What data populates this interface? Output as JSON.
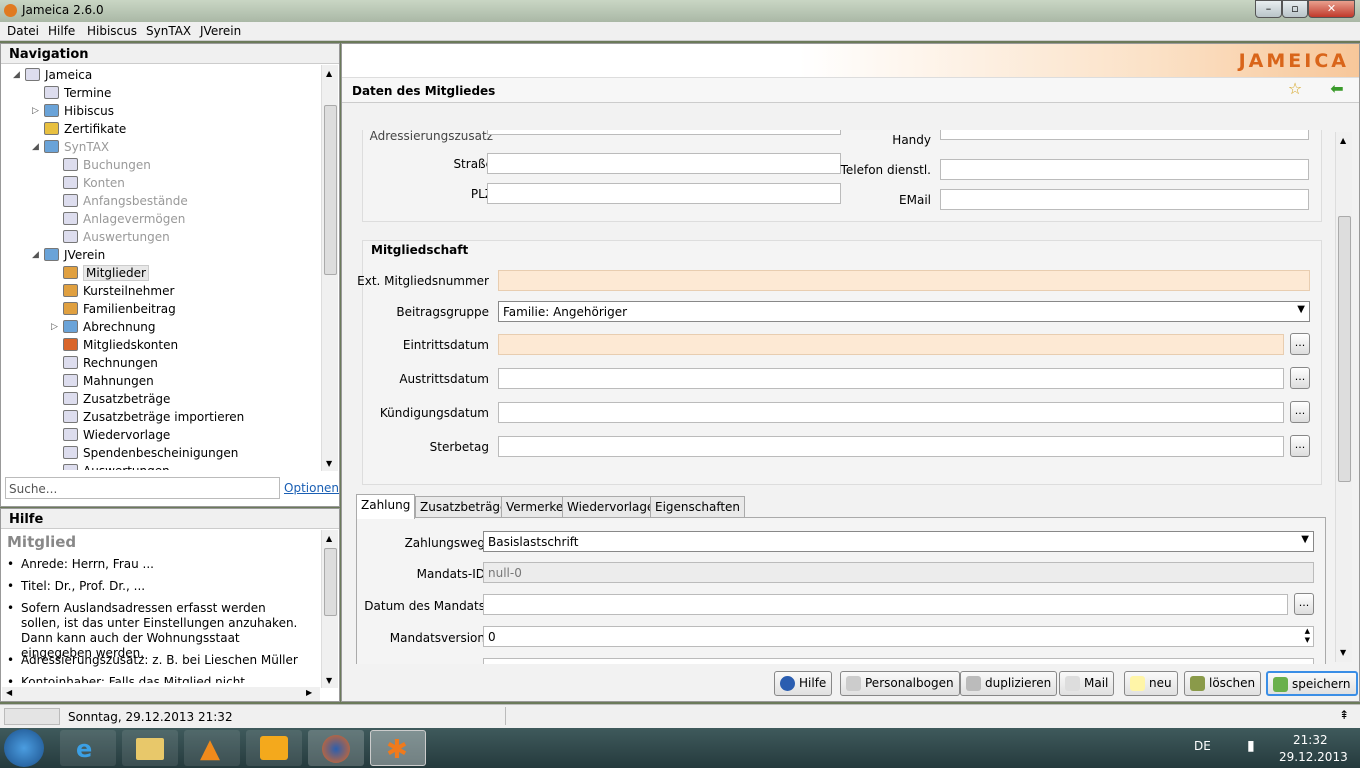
{
  "window": {
    "title": "Jameica 2.6.0"
  },
  "menu": [
    "Datei",
    "Hilfe",
    "Hibiscus",
    "SynTAX",
    "JVerein"
  ],
  "nav": {
    "header": "Navigation",
    "items": [
      {
        "label": "Jameica",
        "level": 0,
        "icon": "computer-icon"
      },
      {
        "label": "Termine",
        "level": 1,
        "icon": "calendar-icon"
      },
      {
        "label": "Hibiscus",
        "level": 1,
        "icon": "folder-icon"
      },
      {
        "label": "Zertifikate",
        "level": 1,
        "icon": "certificate-icon"
      },
      {
        "label": "SynTAX",
        "level": 1,
        "icon": "folder-icon",
        "disabled": true
      },
      {
        "label": "Buchungen",
        "level": 2,
        "icon": "ledger-icon",
        "disabled": true
      },
      {
        "label": "Konten",
        "level": 2,
        "icon": "ledger-icon",
        "disabled": true
      },
      {
        "label": "Anfangsbestände",
        "level": 2,
        "icon": "ledger-icon",
        "disabled": true
      },
      {
        "label": "Anlagevermögen",
        "level": 2,
        "icon": "ledger-icon",
        "disabled": true
      },
      {
        "label": "Auswertungen",
        "level": 2,
        "icon": "report-icon",
        "disabled": true
      },
      {
        "label": "JVerein",
        "level": 1,
        "icon": "folder-icon"
      },
      {
        "label": "Mitglieder",
        "level": 2,
        "icon": "members-icon",
        "selected": true
      },
      {
        "label": "Kursteilnehmer",
        "level": 2,
        "icon": "members-icon"
      },
      {
        "label": "Familienbeitrag",
        "level": 2,
        "icon": "family-icon"
      },
      {
        "label": "Abrechnung",
        "level": 2,
        "icon": "folder-icon"
      },
      {
        "label": "Mitgliedskonten",
        "level": 2,
        "icon": "accounts-icon"
      },
      {
        "label": "Rechnungen",
        "level": 2,
        "icon": "invoice-icon"
      },
      {
        "label": "Mahnungen",
        "level": 2,
        "icon": "reminder-icon"
      },
      {
        "label": "Zusatzbeträge",
        "level": 2,
        "icon": "pencil-icon"
      },
      {
        "label": "Zusatzbeträge importieren",
        "level": 2,
        "icon": "pencil-icon"
      },
      {
        "label": "Wiedervorlage",
        "level": 2,
        "icon": "calendar-icon"
      },
      {
        "label": "Spendenbescheinigungen",
        "level": 2,
        "icon": "document-icon"
      },
      {
        "label": "Auswertungen",
        "level": 2,
        "icon": "report-icon"
      }
    ],
    "search_placeholder": "Suche...",
    "options_link": "Optionen"
  },
  "help": {
    "header": "Hilfe",
    "title": "Mitglied",
    "bullets": [
      "Anrede: Herrn, Frau ...",
      "Titel: Dr., Prof. Dr., ...",
      "Sofern Auslandsadressen erfasst werden sollen, ist das unter Einstellungen anzuhaken. Dann kann auch der Wohnungsstaat eingegeben werden.",
      "Adressierungszusatz: z. B. bei Lieschen Müller",
      "Kontoinhaber: Falls das Mitglied nicht Kontoinhaber ist"
    ]
  },
  "brand": "JAMEICA",
  "main": {
    "title": "Daten des Mitgliedes",
    "address": {
      "adresszusatz": "Adressierungszusatz",
      "strasse": "Straße",
      "plz": "PLZ",
      "handy": "Handy",
      "telefon": "Telefon dienstl.",
      "email": "EMail"
    },
    "membership": {
      "header": "Mitgliedschaft",
      "ext_nr": "Ext. Mitgliedsnummer",
      "beitragsgruppe": "Beitragsgruppe",
      "beitragsgruppe_value": "Familie: Angehöriger",
      "eintritt": "Eintrittsdatum",
      "austritt": "Austrittsdatum",
      "kuendigung": "Kündigungsdatum",
      "sterbetag": "Sterbetag",
      "dots": "..."
    },
    "tabs": [
      "Zahlung",
      "Zusatzbeträge",
      "Vermerke",
      "Wiedervorlage",
      "Eigenschaften"
    ],
    "payment": {
      "zahlungsweg": "Zahlungsweg",
      "zahlungsweg_value": "Basislastschrift",
      "mandats_id": "Mandats-ID",
      "mandats_id_value": "null-0",
      "datum": "Datum des Mandats",
      "version": "Mandatsversion",
      "version_value": "0"
    },
    "buttons": [
      "Hilfe",
      "Personalbogen",
      "duplizieren",
      "Mail",
      "neu",
      "löschen",
      "speichern"
    ]
  },
  "status": {
    "text": "Sonntag, 29.12.2013 21:32"
  },
  "taskbar": {
    "lang": "DE",
    "time": "21:32",
    "date": "29.12.2013"
  }
}
